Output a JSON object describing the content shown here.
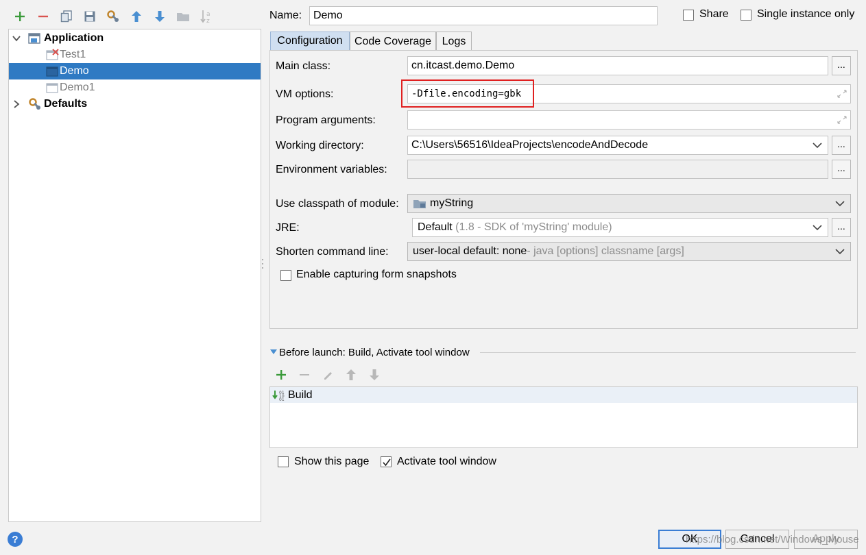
{
  "toolbar": {
    "icons": [
      "add-icon",
      "remove-icon",
      "copy-icon",
      "save-icon",
      "edit-defaults-icon",
      "move-up-icon",
      "move-down-icon",
      "folder-icon",
      "sort-icon"
    ],
    "add_color": "#3a9a3a",
    "remove_color": "#d9534f",
    "arrow_color": "#4a8fd1"
  },
  "tree": {
    "application": "Application",
    "items": [
      {
        "label": "Test1"
      },
      {
        "label": "Demo"
      },
      {
        "label": "Demo1"
      }
    ],
    "defaults": "Defaults"
  },
  "header": {
    "name_label": "Name:",
    "name_value": "Demo",
    "share_label": "Share",
    "single_instance_label": "Single instance only"
  },
  "tabs": [
    "Configuration",
    "Code Coverage",
    "Logs"
  ],
  "form": {
    "main_class_label": "Main class:",
    "main_class_value": "cn.itcast.demo.Demo",
    "vm_options_label": "VM options:",
    "vm_options_value": "-Dfile.encoding=gbk",
    "program_args_label": "Program arguments:",
    "program_args_value": "",
    "working_dir_label": "Working directory:",
    "working_dir_value": "C:\\Users\\56516\\IdeaProjects\\encodeAndDecode",
    "env_vars_label": "Environment variables:",
    "env_vars_value": "",
    "classpath_label": "Use classpath of module:",
    "classpath_value": "myString",
    "jre_label": "JRE:",
    "jre_value": "Default",
    "jre_hint": "(1.8 - SDK of 'myString' module)",
    "shorten_label": "Shorten command line:",
    "shorten_value": "user-local default: none",
    "shorten_hint": " - java [options] classname [args]",
    "capture_label": "Enable capturing form snapshots",
    "dots": "..."
  },
  "before_launch": {
    "title": "Before launch: Build, Activate tool window",
    "items": [
      "Build"
    ],
    "show_page_label": "Show this page",
    "activate_label": "Activate tool window"
  },
  "buttons": {
    "ok": "OK",
    "cancel": "Cancel",
    "apply": "Apply",
    "help": "?"
  },
  "watermark": "https://blog.csdn.net/Windows_Mouse",
  "colors": {
    "selection": "#2f7ac3",
    "highlight_box": "#e02020",
    "active_tab": "#d0dff1"
  }
}
